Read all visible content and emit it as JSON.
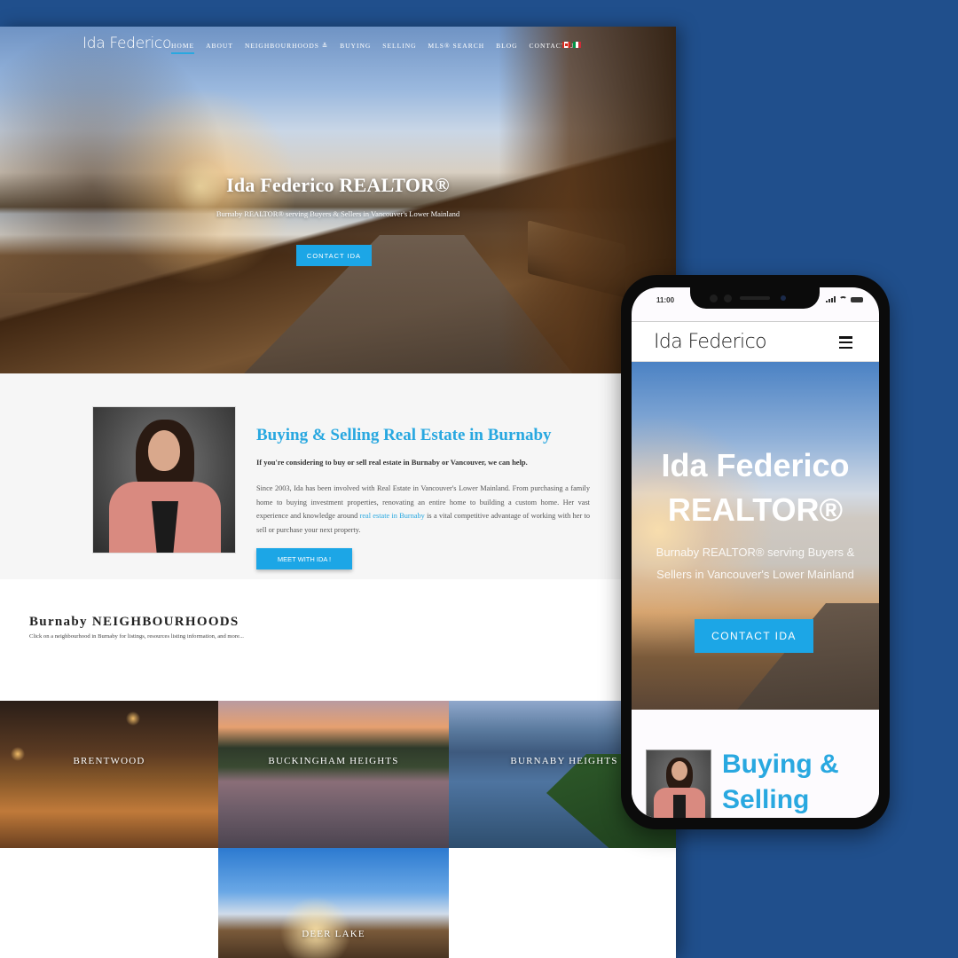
{
  "desktop": {
    "logo": "Ida Federico",
    "nav": [
      {
        "label": "Home",
        "active": true
      },
      {
        "label": "About"
      },
      {
        "label": "Neighbourhoods ≚"
      },
      {
        "label": "Buying"
      },
      {
        "label": "Selling"
      },
      {
        "label": "MLS® Search"
      },
      {
        "label": "Blog"
      },
      {
        "label": "Contact Us"
      }
    ],
    "flags": [
      "canada-flag",
      "italy-flag"
    ],
    "hero": {
      "title": "Ida Federico REALTOR®",
      "subtitle": "Burnaby REALTOR® serving Buyers & Sellers in Vancouver's Lower Mainland",
      "button": "CONTACT IDA"
    },
    "about": {
      "title": "Buying & Selling Real Estate in Burnaby",
      "lead": "If you're considering to buy or sell real estate in Burnaby or Vancouver, we can help.",
      "body_before_link": "Since 2003, Ida has been involved with Real Estate in Vancouver's Lower Mainland. From purchasing a family home to buying investment properties, renovating an entire home to building a custom home. Her vast experience and knowledge around ",
      "link_text": "real estate in Burnaby",
      "body_after_link": " is a vital competitive advantage of working with her to sell or purchase your next property.",
      "button": "MEET WITH IDA !"
    },
    "neighbourhoods": {
      "title": "Burnaby NEIGHBOURHOODS",
      "subtitle": "Click on a neighbourhood in Burnaby for listings, resources listing information, and more...",
      "tiles": [
        {
          "label": "BRENTWOOD"
        },
        {
          "label": "BUCKINGHAM HEIGHTS"
        },
        {
          "label": "BURNABY HEIGHTS"
        },
        {
          "label": "DEER LAKE"
        }
      ]
    }
  },
  "phone": {
    "status_time": "11:00",
    "logo": "Ida Federico",
    "hero": {
      "title": "Ida Federico REALTOR®",
      "subtitle": "Burnaby REALTOR® serving Buyers & Sellers in Vancouver's Lower Mainland",
      "button": "CONTACT IDA"
    },
    "about_title": "Buying & Selling"
  },
  "colors": {
    "background": "#204f8c",
    "accent": "#1ca6e6",
    "heading_blue": "#29a8e0"
  }
}
